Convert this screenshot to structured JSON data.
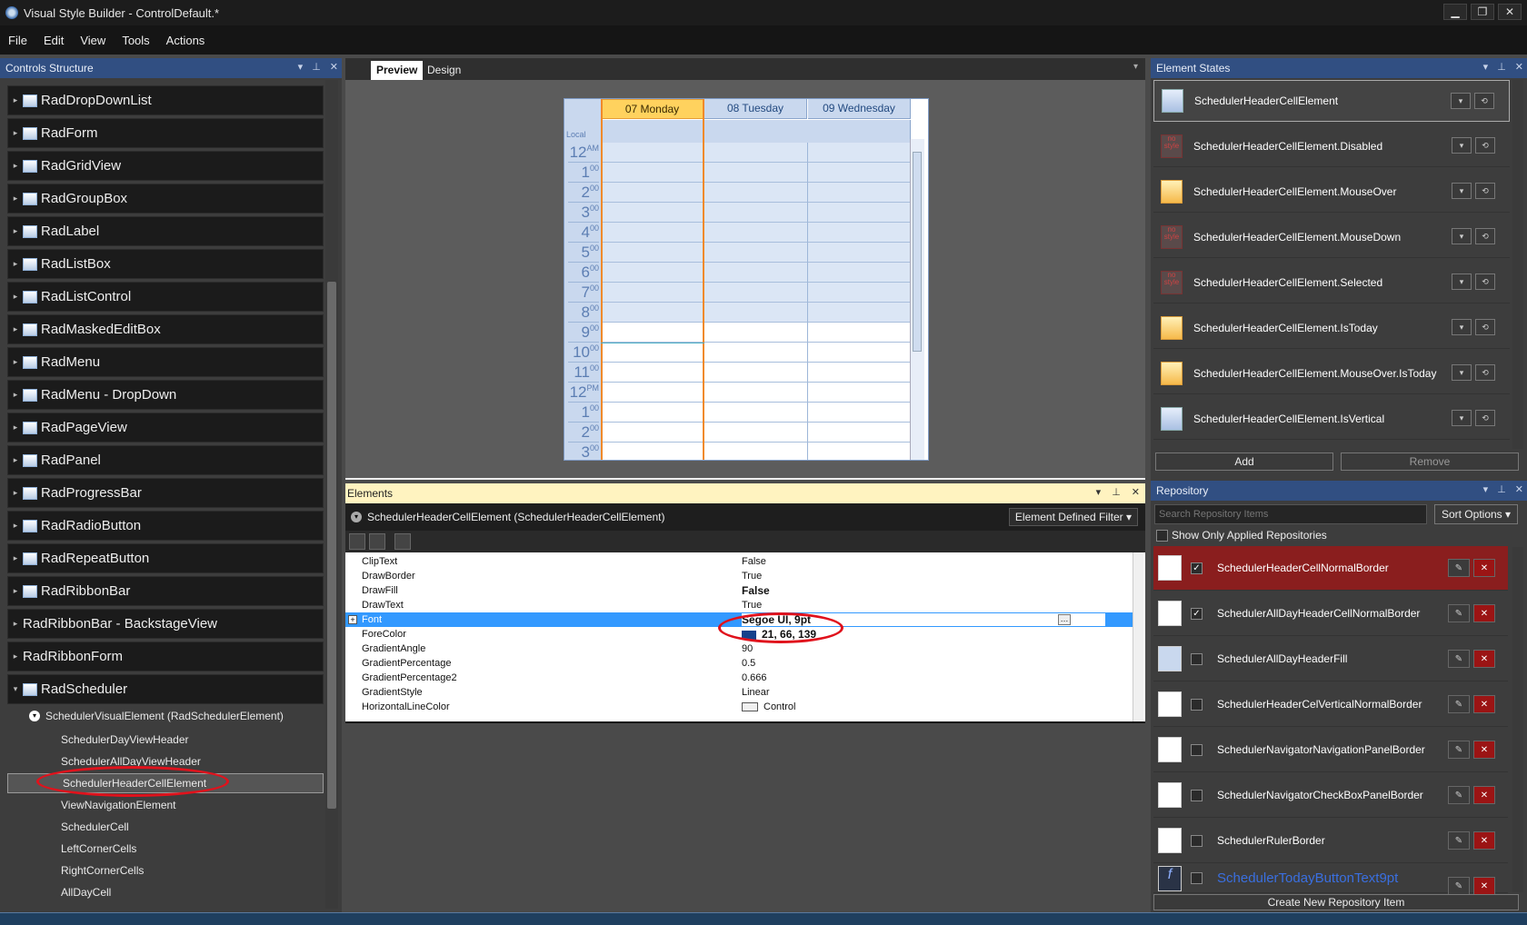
{
  "window": {
    "title": "Visual Style Builder - ControlDefault.*",
    "buttons": [
      "▁",
      "❐",
      "✕"
    ]
  },
  "menu": [
    "File",
    "Edit",
    "View",
    "Tools",
    "Actions"
  ],
  "controls_panel": {
    "title": "Controls Structure",
    "items": [
      "RadDropDownList",
      "RadForm",
      "RadGridView",
      "RadGroupBox",
      "RadLabel",
      "RadListBox",
      "RadListControl",
      "RadMaskedEditBox",
      "RadMenu",
      "RadMenu - DropDown",
      "RadPageView",
      "RadPanel",
      "RadProgressBar",
      "RadRadioButton",
      "RadRepeatButton",
      "RadRibbonBar",
      "RadRibbonBar - BackstageView",
      "RadRibbonForm",
      "RadScheduler"
    ],
    "expanded_root": "SchedulerVisualElement (RadSchedulerElement)",
    "children": [
      "SchedulerDayViewHeader",
      "SchedulerAllDayViewHeader",
      "SchedulerHeaderCellElement",
      "ViewNavigationElement",
      "SchedulerCell",
      "LeftCornerCells",
      "RightCornerCells",
      "AllDayCell"
    ],
    "selected": "SchedulerHeaderCellElement"
  },
  "tabs": {
    "preview": "Preview",
    "design": "Design"
  },
  "scheduler": {
    "local_label": "Local",
    "days": [
      "07 Monday",
      "08 Tuesday",
      "09 Wednesday"
    ],
    "hours": [
      {
        "h": "12",
        "s": "AM"
      },
      {
        "h": "1",
        "s": "00"
      },
      {
        "h": "2",
        "s": "00"
      },
      {
        "h": "3",
        "s": "00"
      },
      {
        "h": "4",
        "s": "00"
      },
      {
        "h": "5",
        "s": "00"
      },
      {
        "h": "6",
        "s": "00"
      },
      {
        "h": "7",
        "s": "00"
      },
      {
        "h": "8",
        "s": "00"
      },
      {
        "h": "9",
        "s": "00"
      },
      {
        "h": "10",
        "s": "00"
      },
      {
        "h": "11",
        "s": "00"
      },
      {
        "h": "12",
        "s": "PM"
      },
      {
        "h": "1",
        "s": "00"
      },
      {
        "h": "2",
        "s": "00"
      },
      {
        "h": "3",
        "s": "00"
      }
    ]
  },
  "elements_panel": {
    "title": "Elements",
    "element": "SchedulerHeaderCellElement (SchedulerHeaderCellElement)",
    "filter": "Element Defined Filter",
    "properties": [
      {
        "name": "ClipText",
        "value": "False"
      },
      {
        "name": "DrawBorder",
        "value": "True"
      },
      {
        "name": "DrawFill",
        "value": "False"
      },
      {
        "name": "DrawText",
        "value": "True"
      },
      {
        "name": "Font",
        "value": "Segoe UI, 9pt"
      },
      {
        "name": "ForeColor",
        "value": "21, 66, 139"
      },
      {
        "name": "GradientAngle",
        "value": "90"
      },
      {
        "name": "GradientPercentage",
        "value": "0.5"
      },
      {
        "name": "GradientPercentage2",
        "value": "0.666"
      },
      {
        "name": "GradientStyle",
        "value": "Linear"
      },
      {
        "name": "HorizontalLineColor",
        "value": "Control"
      }
    ]
  },
  "states_panel": {
    "title": "Element States",
    "states": [
      {
        "label": "SchedulerHeaderCellElement",
        "icon": "normal"
      },
      {
        "label": "SchedulerHeaderCellElement.Disabled",
        "icon": "none"
      },
      {
        "label": "SchedulerHeaderCellElement.MouseOver",
        "icon": "yel"
      },
      {
        "label": "SchedulerHeaderCellElement.MouseDown",
        "icon": "none"
      },
      {
        "label": "SchedulerHeaderCellElement.Selected",
        "icon": "none"
      },
      {
        "label": "SchedulerHeaderCellElement.IsToday",
        "icon": "yel"
      },
      {
        "label": "SchedulerHeaderCellElement.MouseOver.IsToday",
        "icon": "yel"
      },
      {
        "label": "SchedulerHeaderCellElement.IsVertical",
        "icon": "normal"
      }
    ],
    "add": "Add",
    "remove": "Remove",
    "no_style": "no style"
  },
  "repository": {
    "title": "Repository",
    "search_placeholder": "Search Repository Items",
    "sort": "Sort Options",
    "show_only": "Show Only Applied Repositories",
    "items": [
      {
        "label": "SchedulerHeaderCellNormalBorder",
        "checked": true,
        "active": true
      },
      {
        "label": "SchedulerAllDayHeaderCellNormalBorder",
        "checked": true,
        "active": false
      },
      {
        "label": "SchedulerAllDayHeaderFill",
        "checked": false,
        "active": false
      },
      {
        "label": "SchedulerHeaderCelVerticalNormalBorder",
        "checked": false,
        "active": false
      },
      {
        "label": "SchedulerNavigatorNavigationPanelBorder",
        "checked": false,
        "active": false
      },
      {
        "label": "SchedulerNavigatorCheckBoxPanelBorder",
        "checked": false,
        "active": false
      },
      {
        "label": "SchedulerRulerBorder",
        "checked": false,
        "active": false
      },
      {
        "label": "SchedulerTodayButtonText9pt",
        "checked": false,
        "active": false
      }
    ],
    "create": "Create New Repository Item"
  },
  "colors": {
    "accent": "#314f82",
    "today": "#ffd25e",
    "remove": "#9b1414",
    "forecolor_swatch": "#15428b"
  }
}
